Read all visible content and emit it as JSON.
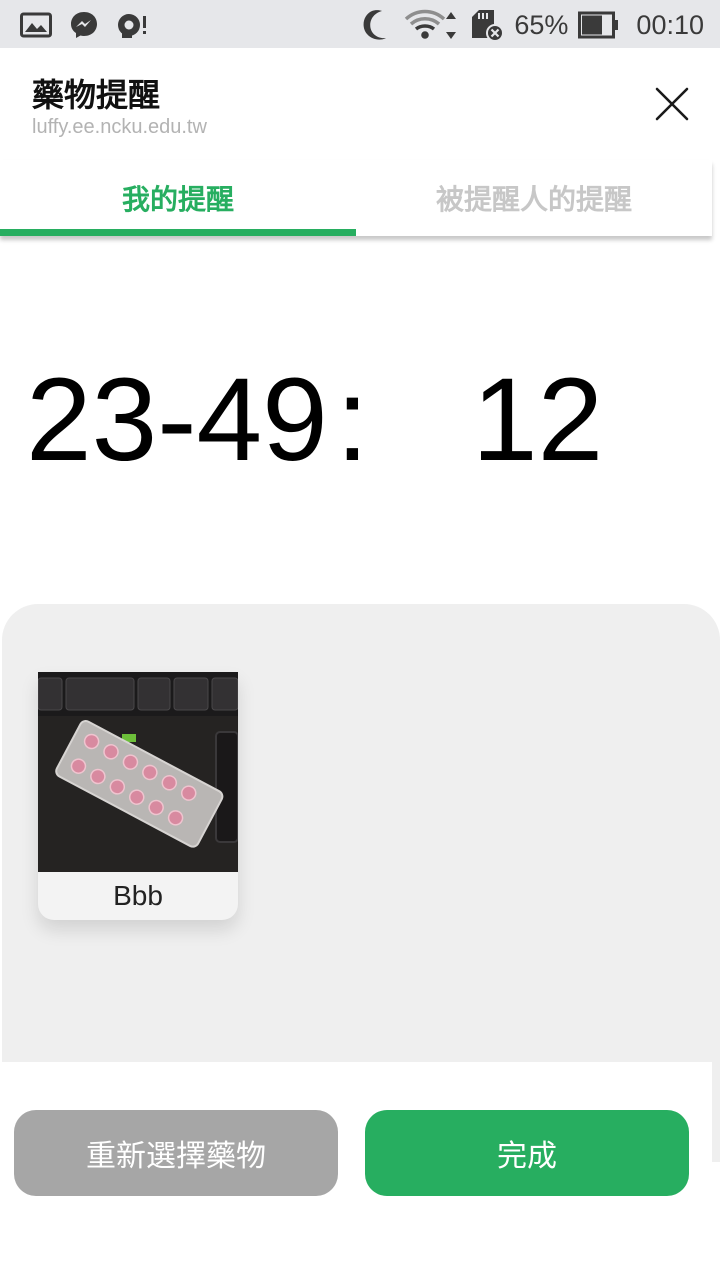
{
  "status_bar": {
    "battery": "65%",
    "time": "00:10",
    "icons": [
      "gallery-icon",
      "messenger-icon",
      "notification-icon",
      "moon-icon",
      "wifi-icon",
      "sd-card-icon",
      "battery-icon"
    ]
  },
  "header": {
    "title": "藥物提醒",
    "subtitle": "luffy.ee.ncku.edu.tw"
  },
  "tabs": [
    {
      "label": "我的提醒",
      "active": true
    },
    {
      "label": "被提醒人的提醒",
      "active": false
    }
  ],
  "time_display": {
    "left": "23-49",
    "separator": ":",
    "right": "12"
  },
  "medicines": [
    {
      "name": "Bbb"
    }
  ],
  "buttons": {
    "reselect": "重新選擇藥物",
    "done": "完成"
  },
  "colors": {
    "accent": "#27ae60",
    "inactive_tab": "#c7c7c7",
    "secondary_button": "#a6a6a6",
    "panel_bg": "#efefef"
  }
}
